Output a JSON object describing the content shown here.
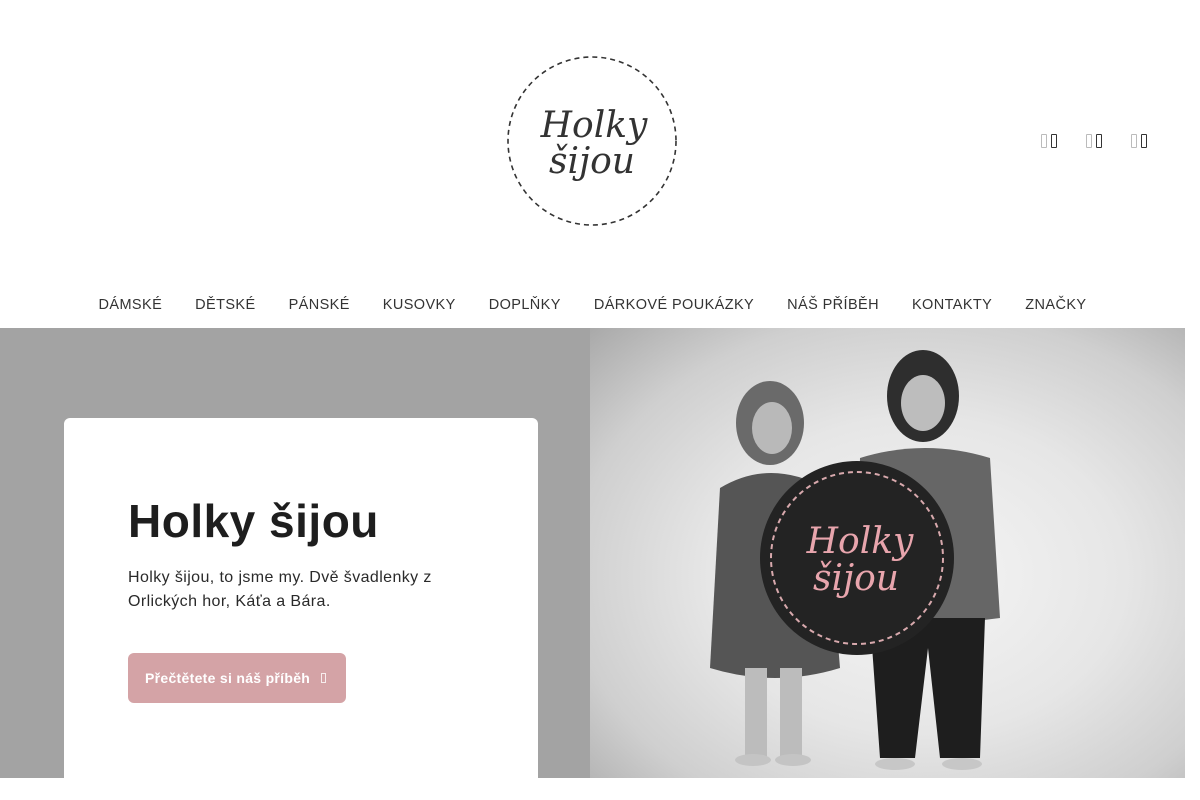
{
  "brand": {
    "logo_line1": "Holky",
    "logo_line2": "šijou"
  },
  "header_icons": [
    {
      "name": "search-icon"
    },
    {
      "name": "user-icon"
    },
    {
      "name": "cart-icon"
    }
  ],
  "nav": {
    "items": [
      "DÁMSKÉ",
      "DĚTSKÉ",
      "PÁNSKÉ",
      "KUSOVKY",
      "DOPLŇKY",
      "DÁRKOVÉ POUKÁZKY",
      "NÁŠ PŘÍBĚH",
      "KONTAKTY",
      "ZNAČKY"
    ]
  },
  "hero": {
    "title": "Holky šijou",
    "text": "Holky šijou, to jsme my. Dvě švadlenky z Orlických hor, Káťa a Bára.",
    "button_label": "Přečtětete si náš příběh",
    "sign_line1": "Holky",
    "sign_line2": "šijou"
  },
  "colors": {
    "accent": "#d4a3a6",
    "hero_bg": "#a3a3a3"
  }
}
